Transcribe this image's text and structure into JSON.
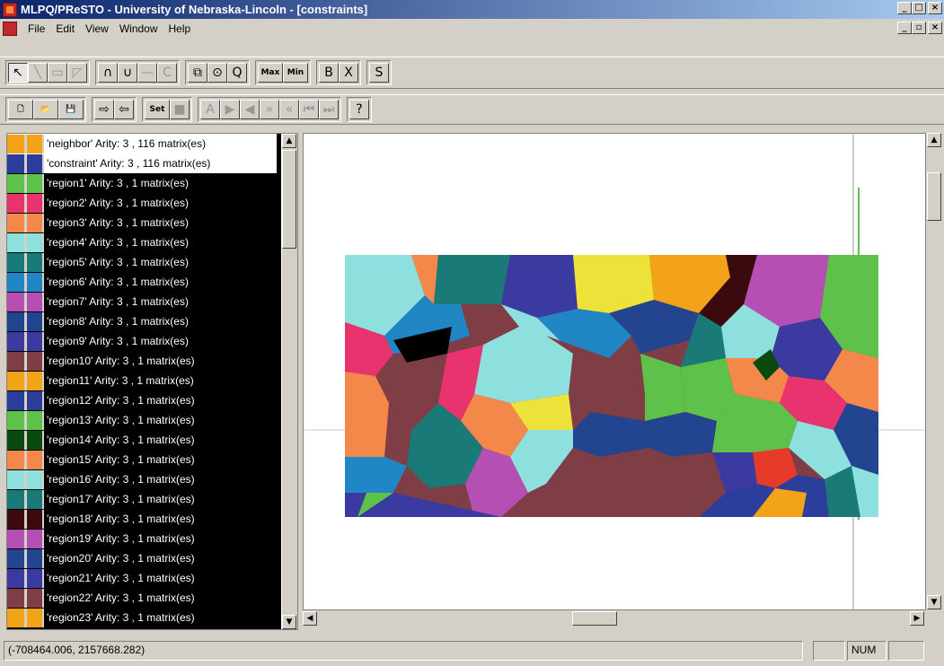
{
  "window": {
    "title": "MLPQ/PReSTO - University of Nebraska-Lincoln - [constraints]",
    "minimize": "_",
    "restore": "□",
    "close": "×",
    "doc_minimize": "_",
    "doc_restore": "▫",
    "doc_close": "×"
  },
  "menu": [
    {
      "label": "File"
    },
    {
      "label": "Edit"
    },
    {
      "label": "View"
    },
    {
      "label": "Window"
    },
    {
      "label": "Help"
    }
  ],
  "toolbar1": [
    {
      "icon": "arrow-icon",
      "glyph": "↖",
      "pressed": true
    },
    {
      "icon": "line-icon",
      "glyph": "╲",
      "disabled": true
    },
    {
      "icon": "rectangle-icon",
      "glyph": "▭",
      "disabled": true
    },
    {
      "icon": "polygon-icon",
      "glyph": "◸",
      "disabled": true
    },
    {
      "icon": "intersection-icon",
      "glyph": "∩"
    },
    {
      "icon": "union-icon",
      "glyph": "∪"
    },
    {
      "icon": "difference-icon",
      "glyph": "—",
      "disabled": true
    },
    {
      "icon": "complement-icon",
      "glyph": "C",
      "disabled": true
    },
    {
      "icon": "buffer-icon",
      "glyph": "⧉"
    },
    {
      "icon": "circle-icon",
      "glyph": "⊙"
    },
    {
      "icon": "query-icon",
      "glyph": "Q"
    },
    {
      "icon": "max-icon",
      "glyph": "Max"
    },
    {
      "icon": "min-icon",
      "glyph": "Min"
    },
    {
      "icon": "bold-b-icon",
      "glyph": "B"
    },
    {
      "icon": "cross-icon",
      "glyph": "X"
    },
    {
      "icon": "s-icon",
      "glyph": "S"
    }
  ],
  "toolbar2": [
    {
      "icon": "new-file-icon",
      "glyph": "🗋"
    },
    {
      "icon": "open-folder-icon",
      "glyph": "📂"
    },
    {
      "icon": "save-disk-icon",
      "glyph": "💾"
    },
    {
      "icon": "export-icon",
      "glyph": "⇨"
    },
    {
      "icon": "import-icon",
      "glyph": "⇦"
    },
    {
      "icon": "set-icon",
      "glyph": "Set"
    },
    {
      "icon": "color-fill-icon",
      "glyph": "■",
      "disabled": true
    },
    {
      "icon": "text-a-icon",
      "glyph": "A",
      "disabled": true
    },
    {
      "icon": "play-icon",
      "glyph": "▶",
      "disabled": true
    },
    {
      "icon": "step-back-icon",
      "glyph": "◀",
      "disabled": true
    },
    {
      "icon": "fast-forward-icon",
      "glyph": "»",
      "disabled": true
    },
    {
      "icon": "rewind-icon",
      "glyph": "«",
      "disabled": true
    },
    {
      "icon": "first-icon",
      "glyph": "⏮",
      "disabled": true
    },
    {
      "icon": "last-icon",
      "glyph": "⏭",
      "disabled": true
    },
    {
      "icon": "help-question-icon",
      "glyph": "?"
    }
  ],
  "layers": [
    {
      "label": "'neighbor'  Arity: 3 , 116 matrix(es)",
      "color": "#f2a318",
      "color2": "#f2a318",
      "selected": false
    },
    {
      "label": "'constraint'  Arity: 3 , 116 matrix(es)",
      "color": "#2c3e9c",
      "color2": "#2c3e9c",
      "selected": false
    },
    {
      "label": "'region1'  Arity: 3 , 1 matrix(es)",
      "color": "#5ec24a",
      "color2": "#5ec24a",
      "selected": true
    },
    {
      "label": "'region2'  Arity: 3 , 1 matrix(es)",
      "color": "#e8336e",
      "color2": "#e8336e",
      "selected": true
    },
    {
      "label": "'region3'  Arity: 3 , 1 matrix(es)",
      "color": "#f4874a",
      "color2": "#f4874a",
      "selected": true
    },
    {
      "label": "'region4'  Arity: 3 , 1 matrix(es)",
      "color": "#8ee0de",
      "color2": "#8ee0de",
      "selected": true
    },
    {
      "label": "'region5'  Arity: 3 , 1 matrix(es)",
      "color": "#1a7a78",
      "color2": "#1a7a78",
      "selected": true
    },
    {
      "label": "'region6'  Arity: 3 , 1 matrix(es)",
      "color": "#2186c4",
      "color2": "#2186c4",
      "selected": true
    },
    {
      "label": "'region7'  Arity: 3 , 1 matrix(es)",
      "color": "#b64fb4",
      "color2": "#b64fb4",
      "selected": true
    },
    {
      "label": "'region8'  Arity: 3 , 1 matrix(es)",
      "color": "#23448e",
      "color2": "#23448e",
      "selected": true
    },
    {
      "label": "'region9'  Arity: 3 , 1 matrix(es)",
      "color": "#3a3aa0",
      "color2": "#3a3aa0",
      "selected": true
    },
    {
      "label": "'region10'  Arity: 3 , 1 matrix(es)",
      "color": "#7f3e46",
      "color2": "#7f3e46",
      "selected": true
    },
    {
      "label": "'region11'  Arity: 3 , 1 matrix(es)",
      "color": "#f2a318",
      "color2": "#f2a318",
      "selected": true
    },
    {
      "label": "'region12'  Arity: 3 , 1 matrix(es)",
      "color": "#2c3e9c",
      "color2": "#2c3e9c",
      "selected": true
    },
    {
      "label": "'region13'  Arity: 3 , 1 matrix(es)",
      "color": "#5ec24a",
      "color2": "#5ec24a",
      "selected": true
    },
    {
      "label": "'region14'  Arity: 3 , 1 matrix(es)",
      "color": "#0a4a10",
      "color2": "#0a4a10",
      "selected": true
    },
    {
      "label": "'region15'  Arity: 3 , 1 matrix(es)",
      "color": "#f4874a",
      "color2": "#f4874a",
      "selected": true
    },
    {
      "label": "'region16'  Arity: 3 , 1 matrix(es)",
      "color": "#8ee0de",
      "color2": "#8ee0de",
      "selected": true
    },
    {
      "label": "'region17'  Arity: 3 , 1 matrix(es)",
      "color": "#1a7a78",
      "color2": "#1a7a78",
      "selected": true
    },
    {
      "label": "'region18'  Arity: 3 , 1 matrix(es)",
      "color": "#3a0a0e",
      "color2": "#3a0a0e",
      "selected": true
    },
    {
      "label": "'region19'  Arity: 3 , 1 matrix(es)",
      "color": "#b64fb4",
      "color2": "#b64fb4",
      "selected": true
    },
    {
      "label": "'region20'  Arity: 3 , 1 matrix(es)",
      "color": "#23448e",
      "color2": "#23448e",
      "selected": true
    },
    {
      "label": "'region21'  Arity: 3 , 1 matrix(es)",
      "color": "#3a3aa0",
      "color2": "#3a3aa0",
      "selected": true
    },
    {
      "label": "'region22'  Arity: 3 , 1 matrix(es)",
      "color": "#7f3e46",
      "color2": "#7f3e46",
      "selected": true
    },
    {
      "label": "'region23'  Arity: 3 , 1 matrix(es)",
      "color": "#f2a318",
      "color2": "#f2a318",
      "selected": true
    }
  ],
  "status": {
    "coordinates": "(-708464.006, 2157668.282)",
    "num": "NUM"
  },
  "colors": {
    "titlebar_start": "#0a246a",
    "titlebar_end": "#a6caf0",
    "chrome": "#d4d0c8"
  }
}
